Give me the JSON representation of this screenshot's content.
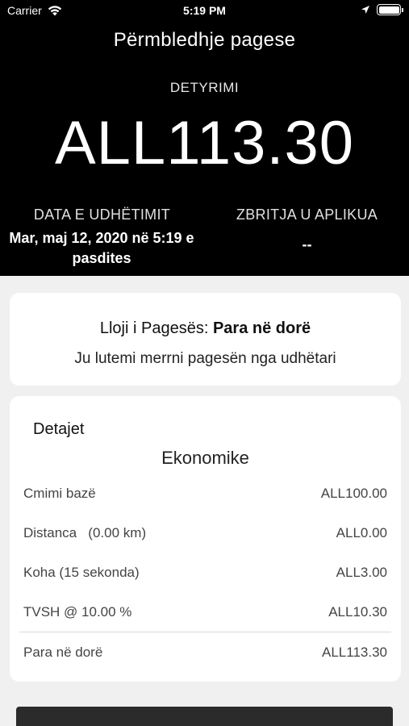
{
  "status_bar": {
    "carrier": "Carrier",
    "time": "5:19 PM"
  },
  "header": {
    "title": "Përmbledhje pagese",
    "due_label": "DETYRIMI",
    "amount": "ALL113.30",
    "trip_date_label": "DATA E UDHËTIMIT",
    "trip_date_value": "Mar, maj 12, 2020 në 5:19 e pasdites",
    "discount_label": "ZBRITJA U APLIKUA",
    "discount_value": "--"
  },
  "payment_card": {
    "type_label": "Lloji i Pagesës:",
    "type_value": "Para në dorë",
    "note": "Ju lutemi merrni pagesën nga udhëtari"
  },
  "details_card": {
    "title": "Detajet",
    "vehicle_class": "Ekonomike",
    "rows": [
      {
        "label": "Cmimi bazë",
        "value": "ALL100.00"
      },
      {
        "label": "Distanca   (0.00 km)",
        "value": "ALL0.00"
      },
      {
        "label": "Koha (15 sekonda)",
        "value": "ALL3.00"
      },
      {
        "label": "TVSH @ 10.00 %",
        "value": "ALL10.30"
      }
    ],
    "total": {
      "label": "Para në dorë",
      "value": "ALL113.30"
    }
  },
  "icons": [
    "wifi-icon",
    "location-arrow-icon",
    "battery-icon"
  ],
  "colors": {
    "header_bg": "#000000",
    "page_bg": "#f0f0f0",
    "card_bg": "#ffffff",
    "bottom_button": "#2b2b2b"
  }
}
